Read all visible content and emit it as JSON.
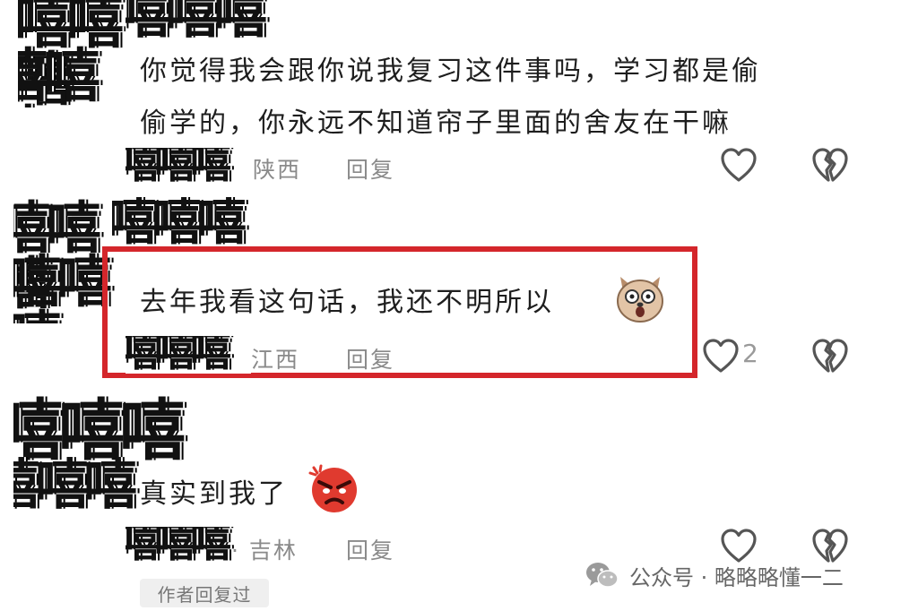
{
  "comments": [
    {
      "avatar_text": "嘻嘻嘻",
      "text_line1": "你觉得我会跟你说我复习这件事吗，学习都是偷",
      "text_line2": "偷学的，你永远不知道帘子里面的舍友在干嘛",
      "location": "陕西",
      "reply_label": "回复"
    },
    {
      "avatar_text": "嘻嘻嘻",
      "text_line1": "去年我看这句话，我还不明所以",
      "location": "江西",
      "reply_label": "回复",
      "like_count": "2"
    },
    {
      "avatar_text": "嘻嘻嘻",
      "text_line1": "真实到我了",
      "location": "· 吉林",
      "reply_label": "回复",
      "author_badge": "作者回复过"
    }
  ],
  "watermark": {
    "text": "公众号 · 略略略懂一二",
    "icon": "wechat-icon"
  },
  "colors": {
    "highlight_border": "#d4262b",
    "meta_text": "#8a8a8a"
  }
}
